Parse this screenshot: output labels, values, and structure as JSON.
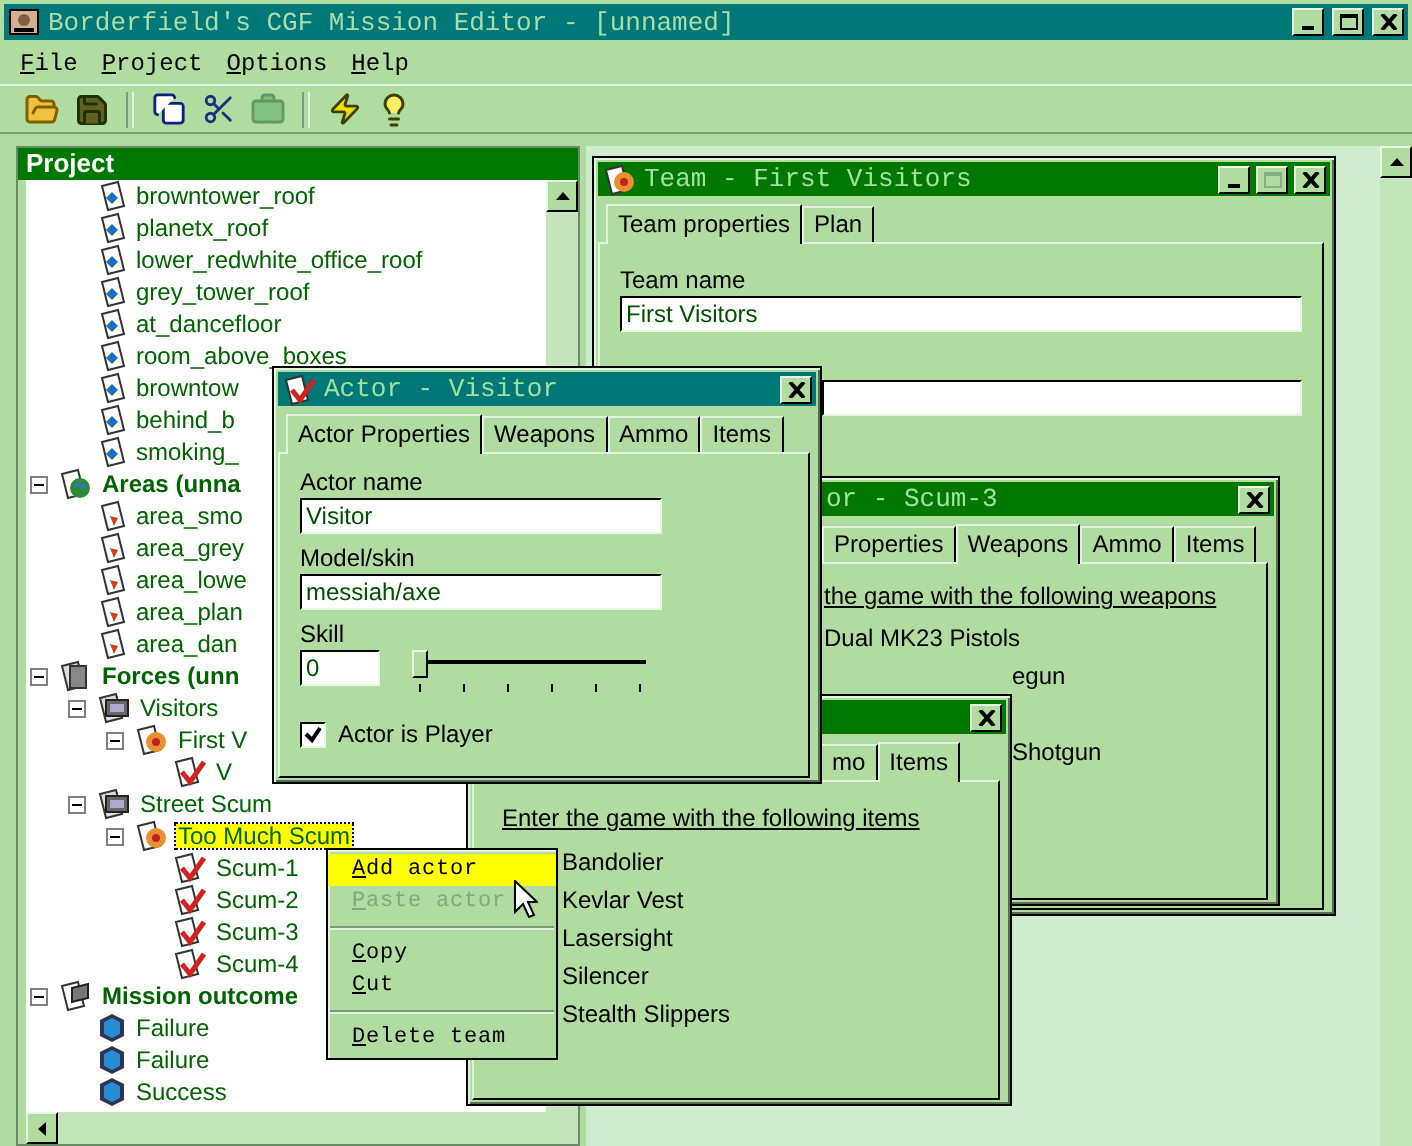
{
  "window": {
    "title": "Borderfield's CGF Mission Editor - [unnamed]"
  },
  "menu": [
    {
      "label": "File"
    },
    {
      "label": "Project"
    },
    {
      "label": "Options"
    },
    {
      "label": "Help"
    }
  ],
  "project_panel": {
    "title": "Project",
    "tree": [
      {
        "kind": "continued",
        "children": [
          {
            "label": "browntower_roof",
            "kind": "location",
            "selected": false
          },
          {
            "label": "planetx_roof",
            "kind": "location",
            "selected": false
          },
          {
            "label": "lower_redwhite_office_roof",
            "kind": "location",
            "selected": false
          },
          {
            "label": "grey_tower_roof",
            "kind": "location",
            "selected": false
          },
          {
            "label": "at_dancefloor",
            "kind": "location",
            "selected": false
          },
          {
            "label": "room_above_boxes",
            "kind": "location",
            "selected": false
          },
          {
            "label": "browntow",
            "kind": "location",
            "selected": false
          },
          {
            "label": "behind_b",
            "kind": "location",
            "selected": false
          },
          {
            "label": "smoking_",
            "kind": "location",
            "selected": false
          }
        ]
      },
      {
        "label": "Areas (unna",
        "kind": "areas",
        "expanded": true,
        "selected": false,
        "children": [
          {
            "label": "area_smo",
            "kind": "area",
            "selected": false
          },
          {
            "label": "area_grey",
            "kind": "area",
            "selected": false
          },
          {
            "label": "area_lowe",
            "kind": "area",
            "selected": false
          },
          {
            "label": "area_plan",
            "kind": "area",
            "selected": false
          },
          {
            "label": "area_dan",
            "kind": "area",
            "selected": false
          }
        ]
      },
      {
        "label": "Forces (unn",
        "kind": "forces",
        "expanded": true,
        "selected": false,
        "children": [
          {
            "label": "Visitors",
            "kind": "force",
            "expanded": true,
            "selected": false,
            "children": [
              {
                "label": "First V",
                "kind": "team",
                "expanded": true,
                "selected": false,
                "children": [
                  {
                    "label": "V",
                    "kind": "actor",
                    "selected": false
                  }
                ]
              }
            ]
          },
          {
            "label": "Street Scum",
            "kind": "force",
            "expanded": true,
            "selected": false,
            "children": [
              {
                "label": "Too Much Scum",
                "kind": "team",
                "expanded": true,
                "selected": true,
                "children": [
                  {
                    "label": "Scum-1",
                    "kind": "actor",
                    "selected": false
                  },
                  {
                    "label": "Scum-2",
                    "kind": "actor",
                    "selected": false
                  },
                  {
                    "label": "Scum-3",
                    "kind": "actor",
                    "selected": false
                  },
                  {
                    "label": "Scum-4",
                    "kind": "actor",
                    "selected": false
                  }
                ]
              }
            ]
          }
        ]
      },
      {
        "label": "Mission outcome",
        "kind": "outcomes",
        "expanded": true,
        "selected": false,
        "children": [
          {
            "label": "Failure",
            "kind": "outcome",
            "selected": false
          },
          {
            "label": "Failure",
            "kind": "outcome",
            "selected": false
          },
          {
            "label": "Success",
            "kind": "outcome",
            "selected": false
          }
        ]
      }
    ]
  },
  "team_window": {
    "title": "Team - First Visitors",
    "tabs": [
      {
        "label": "Team properties",
        "selected": true
      },
      {
        "label": "Plan",
        "selected": false
      }
    ],
    "team_name": {
      "label": "Team name",
      "value": "First Visitors"
    }
  },
  "scum_window": {
    "title": "or - Scum-3",
    "tabs": [
      {
        "label": "Properties",
        "selected": false
      },
      {
        "label": "Weapons",
        "selected": true
      },
      {
        "label": "Ammo",
        "selected": false
      },
      {
        "label": "Items",
        "selected": false
      }
    ],
    "heading": "the game with the following weapons",
    "weapons": [
      {
        "name": "Dual MK23 Pistols",
        "kind": "full"
      },
      {
        "name": "egun",
        "kind": "cut"
      },
      {
        "name": "Shotgun",
        "kind": "cut_below"
      }
    ]
  },
  "items_window": {
    "tabs": [
      {
        "label": "mo",
        "selected": false
      },
      {
        "label": "Items",
        "selected": true
      }
    ],
    "heading": "Enter the game with the following items",
    "items": [
      "Bandolier",
      "Kevlar Vest",
      "Lasersight",
      "Silencer",
      "Stealth Slippers"
    ]
  },
  "actor_window": {
    "title": "Actor - Visitor",
    "tabs": [
      {
        "label": "Actor Properties",
        "selected": true
      },
      {
        "label": "Weapons",
        "selected": false
      },
      {
        "label": "Ammo",
        "selected": false
      },
      {
        "label": "Items",
        "selected": false
      }
    ],
    "actor_name": {
      "label": "Actor name",
      "value": "Visitor"
    },
    "model": {
      "label": "Model/skin",
      "value": "messiah/axe"
    },
    "skill": {
      "label": "Skill",
      "value": "0",
      "level": 0
    },
    "is_player": {
      "label": "Actor is Player",
      "checked": true
    }
  },
  "context_menu": [
    {
      "kind": "item",
      "label": "Add actor",
      "highlighted": true,
      "disabled": false
    },
    {
      "kind": "item",
      "label": "Paste actor",
      "highlighted": false,
      "disabled": true
    },
    {
      "kind": "separator"
    },
    {
      "kind": "item",
      "label": "Copy",
      "highlighted": false,
      "disabled": false
    },
    {
      "kind": "item",
      "label": "Cut",
      "highlighted": false,
      "disabled": false
    },
    {
      "kind": "separator"
    },
    {
      "kind": "item",
      "label": "Delete team",
      "highlighted": false,
      "disabled": false
    }
  ]
}
